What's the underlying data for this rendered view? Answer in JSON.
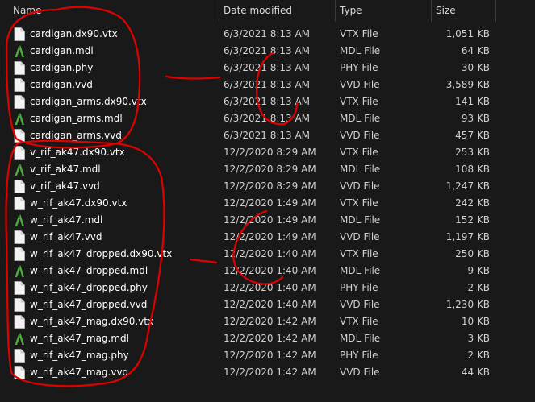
{
  "columns": {
    "name": "Name",
    "date": "Date modified",
    "type": "Type",
    "size": "Size"
  },
  "files": [
    {
      "name": "cardigan.dx90.vtx",
      "date": "6/3/2021 8:13 AM",
      "type": "VTX File",
      "size": "1,051 KB",
      "icon": "document-icon"
    },
    {
      "name": "cardigan.mdl",
      "date": "6/3/2021 8:13 AM",
      "type": "MDL File",
      "size": "64 KB",
      "icon": "mdl-arch-icon"
    },
    {
      "name": "cardigan.phy",
      "date": "6/3/2021 8:13 AM",
      "type": "PHY File",
      "size": "30 KB",
      "icon": "document-icon"
    },
    {
      "name": "cardigan.vvd",
      "date": "6/3/2021 8:13 AM",
      "type": "VVD File",
      "size": "3,589 KB",
      "icon": "document-icon"
    },
    {
      "name": "cardigan_arms.dx90.vtx",
      "date": "6/3/2021 8:13 AM",
      "type": "VTX File",
      "size": "141 KB",
      "icon": "document-icon"
    },
    {
      "name": "cardigan_arms.mdl",
      "date": "6/3/2021 8:13 AM",
      "type": "MDL File",
      "size": "93 KB",
      "icon": "mdl-arch-icon"
    },
    {
      "name": "cardigan_arms.vvd",
      "date": "6/3/2021 8:13 AM",
      "type": "VVD File",
      "size": "457 KB",
      "icon": "document-icon"
    },
    {
      "name": "v_rif_ak47.dx90.vtx",
      "date": "12/2/2020 8:29 AM",
      "type": "VTX File",
      "size": "253 KB",
      "icon": "document-icon"
    },
    {
      "name": "v_rif_ak47.mdl",
      "date": "12/2/2020 8:29 AM",
      "type": "MDL File",
      "size": "108 KB",
      "icon": "mdl-arch-icon"
    },
    {
      "name": "v_rif_ak47.vvd",
      "date": "12/2/2020 8:29 AM",
      "type": "VVD File",
      "size": "1,247 KB",
      "icon": "document-icon"
    },
    {
      "name": "w_rif_ak47.dx90.vtx",
      "date": "12/2/2020 1:49 AM",
      "type": "VTX File",
      "size": "242 KB",
      "icon": "document-icon"
    },
    {
      "name": "w_rif_ak47.mdl",
      "date": "12/2/2020 1:49 AM",
      "type": "MDL File",
      "size": "152 KB",
      "icon": "mdl-arch-icon"
    },
    {
      "name": "w_rif_ak47.vvd",
      "date": "12/2/2020 1:49 AM",
      "type": "VVD File",
      "size": "1,197 KB",
      "icon": "document-icon"
    },
    {
      "name": "w_rif_ak47_dropped.dx90.vtx",
      "date": "12/2/2020 1:40 AM",
      "type": "VTX File",
      "size": "250 KB",
      "icon": "document-icon"
    },
    {
      "name": "w_rif_ak47_dropped.mdl",
      "date": "12/2/2020 1:40 AM",
      "type": "MDL File",
      "size": "9 KB",
      "icon": "mdl-arch-icon"
    },
    {
      "name": "w_rif_ak47_dropped.phy",
      "date": "12/2/2020 1:40 AM",
      "type": "PHY File",
      "size": "2 KB",
      "icon": "document-icon"
    },
    {
      "name": "w_rif_ak47_dropped.vvd",
      "date": "12/2/2020 1:40 AM",
      "type": "VVD File",
      "size": "1,230 KB",
      "icon": "document-icon"
    },
    {
      "name": "w_rif_ak47_mag.dx90.vtx",
      "date": "12/2/2020 1:42 AM",
      "type": "VTX File",
      "size": "10 KB",
      "icon": "document-icon"
    },
    {
      "name": "w_rif_ak47_mag.mdl",
      "date": "12/2/2020 1:42 AM",
      "type": "MDL File",
      "size": "3 KB",
      "icon": "mdl-arch-icon"
    },
    {
      "name": "w_rif_ak47_mag.phy",
      "date": "12/2/2020 1:42 AM",
      "type": "PHY File",
      "size": "2 KB",
      "icon": "document-icon"
    },
    {
      "name": "w_rif_ak47_mag.vvd",
      "date": "12/2/2020 1:42 AM",
      "type": "VVD File",
      "size": "44 KB",
      "icon": "document-icon"
    }
  ],
  "colors": {
    "background": "#191919",
    "text": "#ffffff",
    "header_text": "#d9d9d9",
    "annotation_red": "#e00000",
    "mdl_icon_green": "#4caf3a"
  }
}
